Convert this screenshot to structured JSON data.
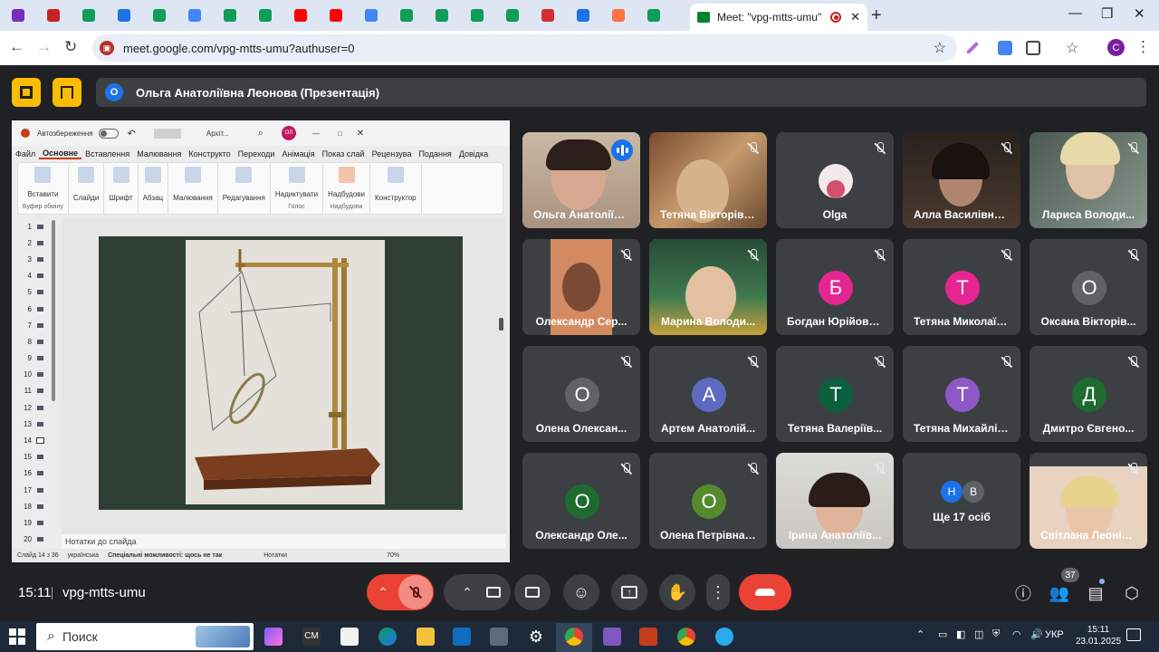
{
  "browser": {
    "active_tab_title": "Meet: \"vpg-mtts-umu\"",
    "url": "meet.google.com/vpg-mtts-umu?authuser=0",
    "profile_initial": "C",
    "favicon_colors": [
      "#7b2cbf",
      "#c5221f",
      "#0f9d58",
      "#1a73e8",
      "#0f9d58",
      "#4285f4",
      "#0f9d58",
      "#0f9d58",
      "#ff0000",
      "#ff0000",
      "#4285f4",
      "#0f9d58",
      "#0f9d58",
      "#0f9d58",
      "#0f9d58",
      "#d32f2f",
      "#1a73e8",
      "#ff7043",
      "#0f9d58"
    ]
  },
  "meet": {
    "presenter_initial": "О",
    "presenter_banner": "Ольга Анатоліївна Леонова (Презентація)",
    "meeting_time": "15:11",
    "meeting_code": "vpg-mtts-umu",
    "participant_count": "37",
    "tiles": [
      {
        "name": "Ольга Анатоліїв...",
        "type": "video",
        "speaking": true,
        "bg": "#b8a590"
      },
      {
        "name": "Тетяна Вікторівн...",
        "type": "video",
        "bg": "#8d6a4a"
      },
      {
        "name": "Olga",
        "type": "photo",
        "bg": "#3c4043"
      },
      {
        "name": "Алла Василівна ...",
        "type": "video",
        "bg": "#3a2e28"
      },
      {
        "name": "Лариса Володи...",
        "type": "video",
        "bg": "#6b7a70"
      },
      {
        "name": "Олександр Сер...",
        "type": "video",
        "bg": "#a0684c"
      },
      {
        "name": "Марина Володи...",
        "type": "video",
        "bg": "#3f6b4b"
      },
      {
        "name": "Богдан Юрійови...",
        "type": "avatar",
        "initial": "Б",
        "color": "#e52592"
      },
      {
        "name": "Тетяна Миколаїв...",
        "type": "avatar",
        "initial": "Т",
        "color": "#e52592"
      },
      {
        "name": "Оксана Вікторів...",
        "type": "avatar",
        "initial": "О",
        "color": "#5f6368"
      },
      {
        "name": "Олена Олексан...",
        "type": "avatar",
        "initial": "О",
        "color": "#5f6368"
      },
      {
        "name": "Артем Анатолій...",
        "type": "avatar",
        "initial": "А",
        "color": "#5c6bc0"
      },
      {
        "name": "Тетяна Валеріїв...",
        "type": "avatar",
        "initial": "Т",
        "color": "#0b5e3e"
      },
      {
        "name": "Тетяна Михайлів...",
        "type": "avatar",
        "initial": "Т",
        "color": "#8e58c6"
      },
      {
        "name": "Дмитро Євгено...",
        "type": "avatar",
        "initial": "Д",
        "color": "#1e6b30"
      },
      {
        "name": "Олександр Оле...",
        "type": "avatar",
        "initial": "О",
        "color": "#1e6b30"
      },
      {
        "name": "Олена Петрівна ...",
        "type": "avatar",
        "initial": "О",
        "color": "#558b2f"
      },
      {
        "name": "Ірина Анатоліїв...",
        "type": "video",
        "bg": "#d9dad6"
      },
      {
        "name": "Ще 17 осіб",
        "type": "more",
        "initials": [
          "Н",
          "В"
        ]
      },
      {
        "name": "Світлана Леонід...",
        "type": "video",
        "bg": "#c99a6b"
      }
    ]
  },
  "powerpoint": {
    "autosave": "Автозбереження",
    "filename": "Архіт...",
    "user_initials": "ОЛ",
    "menu": [
      "Файл",
      "Основне",
      "Вставлення",
      "Малювання",
      "Конструкто",
      "Переходи",
      "Анімація",
      "Показ слай",
      "Рецензува",
      "Подання",
      "Довідка"
    ],
    "ribbon": [
      "Вставити",
      "Слайди",
      "Шрифт",
      "Абзац",
      "Малювання",
      "Редагування",
      "Надиктувати",
      "Надбудови",
      "Конструктор"
    ],
    "ribbon_groups": [
      "Буфер обміну",
      "Голос",
      "Надбудови"
    ],
    "slide_numbers": [
      "1",
      "2",
      "3",
      "4",
      "5",
      "6",
      "7",
      "8",
      "9",
      "10",
      "11",
      "12",
      "13",
      "14",
      "15",
      "16",
      "17",
      "18",
      "19",
      "20"
    ],
    "notes": "Нотатки до слайда",
    "status_slide": "Слайд 14 з 36",
    "status_lang": "українська",
    "status_access": "Спеціальні можливості: щось не так",
    "status_notes": "Нотатки",
    "zoom": "70%"
  },
  "taskbar": {
    "search": "Поиск",
    "lang": "УКР",
    "time": "15:11",
    "date": "23.01.2025"
  }
}
